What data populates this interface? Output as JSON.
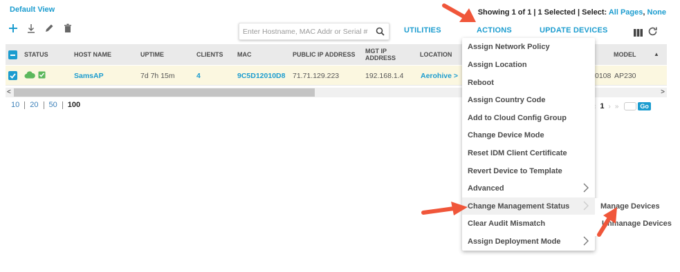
{
  "header": {
    "view_title": "Default View",
    "showing_prefix": "Showing 1 of 1 | 1 Selected | Select: ",
    "all_pages": "All Pages",
    "separator": ", ",
    "none": "None"
  },
  "toolbar": {
    "add_icon": "plus-icon",
    "download_icon": "download-icon",
    "edit_icon": "pencil-icon",
    "delete_icon": "trash-icon"
  },
  "search": {
    "placeholder": "Enter Hostname, MAC Addr or Serial #",
    "value": ""
  },
  "top_links": {
    "utilities": "UTILITIES",
    "actions": "ACTIONS",
    "update_devices": "UPDATE DEVICES"
  },
  "table": {
    "headers": {
      "status": "STATUS",
      "host_name": "HOST NAME",
      "uptime": "UPTIME",
      "clients": "CLIENTS",
      "mac": "MAC",
      "public_ip": "PUBLIC IP ADDRESS",
      "mgt_ip_line1": "MGT IP",
      "mgt_ip_line2": "ADDRESS",
      "location": "LOCATION",
      "model": "MODEL"
    },
    "rows": [
      {
        "host_name": "SamsAP",
        "uptime": "7d 7h 15m",
        "clients": "4",
        "mac": "9C5D12010D8",
        "public_ip": "71.71.129.223",
        "mgt_ip": "192.168.1.4",
        "location": "Aerohive >",
        "serial_fragment": "0108",
        "model": "AP230"
      }
    ]
  },
  "page_sizes": [
    "10",
    "20",
    "50",
    "100"
  ],
  "pager": {
    "current": "1",
    "go": "Go"
  },
  "actions_menu": [
    "Assign Network Policy",
    "Assign Location",
    "Reboot",
    "Assign Country Code",
    "Add to Cloud Config Group",
    "Change Device Mode",
    "Reset IDM Client Certificate",
    "Revert Device to Template",
    "Advanced",
    "Change Management Status",
    "Clear Audit Mismatch",
    "Assign Deployment Mode"
  ],
  "submenu": [
    "Manage Devices",
    "Unmanage Devices"
  ],
  "colors": {
    "accent": "#1b9ccf",
    "status_green": "#5cb85c",
    "highlight_row": "#fbf7e0",
    "arrow": "#f0563a"
  }
}
